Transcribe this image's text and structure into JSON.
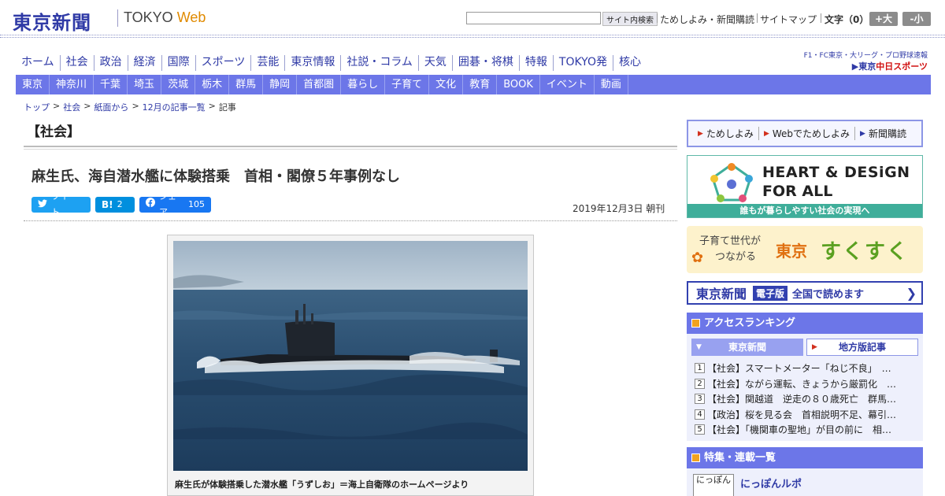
{
  "header": {
    "logo": "東京新聞",
    "logo_en_main": "TOKYO ",
    "logo_en_web": "Web",
    "search_button": "サイト内検索",
    "search_value": "",
    "link_trial": "ためしよみ・新聞購読",
    "link_sitemap": "サイトマップ",
    "font_label": "文字（0）",
    "font_larger": "+大",
    "font_smaller": "-小"
  },
  "nav_main": [
    "ホーム",
    "社会",
    "政治",
    "経済",
    "国際",
    "スポーツ",
    "芸能",
    "東京情報",
    "社説・コラム",
    "天気",
    "囲碁・将棋",
    "特報",
    "TOKYO発",
    "核心"
  ],
  "sports_ad": {
    "line1": "F1・FC東京・大リーグ・プロ野球速報",
    "prefix": "▶東京",
    "brand": "中日スポーツ"
  },
  "nav_region": [
    "東京",
    "神奈川",
    "千葉",
    "埼玉",
    "茨城",
    "栃木",
    "群馬",
    "静岡",
    "首都圏",
    "暮らし",
    "子育て",
    "文化",
    "教育",
    "BOOK",
    "イベント",
    "動画"
  ],
  "breadcrumb": [
    "トップ",
    "社会",
    "紙面から",
    "12月の記事一覧",
    "記事"
  ],
  "breadcrumb_sep": ">",
  "article": {
    "section": "【社会】",
    "title": "麻生氏、海自潜水艦に体験搭乗　首相・閣僚５年事例なし",
    "date": "2019年12月3日 朝刊",
    "photo_caption": "麻生氏が体験搭乗した潜水艦「うずしお」＝海上自衛隊のホームページより"
  },
  "share": {
    "tweet_label": "ツイート",
    "hatena_icon": "B!",
    "hatena_count": "2",
    "fb_label": "シェア",
    "fb_count": "105"
  },
  "sidebar": {
    "links": [
      "ためしよみ",
      "Webでためしよみ",
      "新聞購読"
    ],
    "hd_title1": "HEART & DESiGN",
    "hd_title2": "FOR ALL",
    "hd_footer": "誰もが暮らしやすい社会の実現へ",
    "sk_sub1": "子育て世代が",
    "sk_sub2": "つながる",
    "sk_brand1": "東京",
    "sk_brand2": "すくすく",
    "ep_name": "東京新聞",
    "ep_badge": "電子版",
    "ep_text": "全国で読めます",
    "ranking_title": "アクセスランキング",
    "ranking_tab_tokyo": "東京新聞",
    "ranking_tab_local": "地方版記事",
    "ranking": [
      {
        "num": "1",
        "text": "【社会】スマートメーター「ねじ不良」　…"
      },
      {
        "num": "2",
        "text": "【社会】ながら運転、きょうから厳罰化　…"
      },
      {
        "num": "3",
        "text": "【社会】関越道　逆走の８０歳死亡　群馬…"
      },
      {
        "num": "4",
        "text": "【政治】桜を見る会　首相説明不足、幕引…"
      },
      {
        "num": "5",
        "text": "【社会】「機関車の聖地」が目の前に　相…"
      }
    ],
    "tokushu_title": "特集・連載一覧",
    "nippon_thumb": "にっぽん",
    "nippon_title": "にっぽんルポ"
  },
  "colors": {
    "brand": "#2f3aa6",
    "nav_bg": "#6c76e8",
    "accent_orange": "#f1a21f",
    "twitter": "#1da1f2",
    "hatena": "#008fde",
    "facebook": "#1877f2"
  }
}
